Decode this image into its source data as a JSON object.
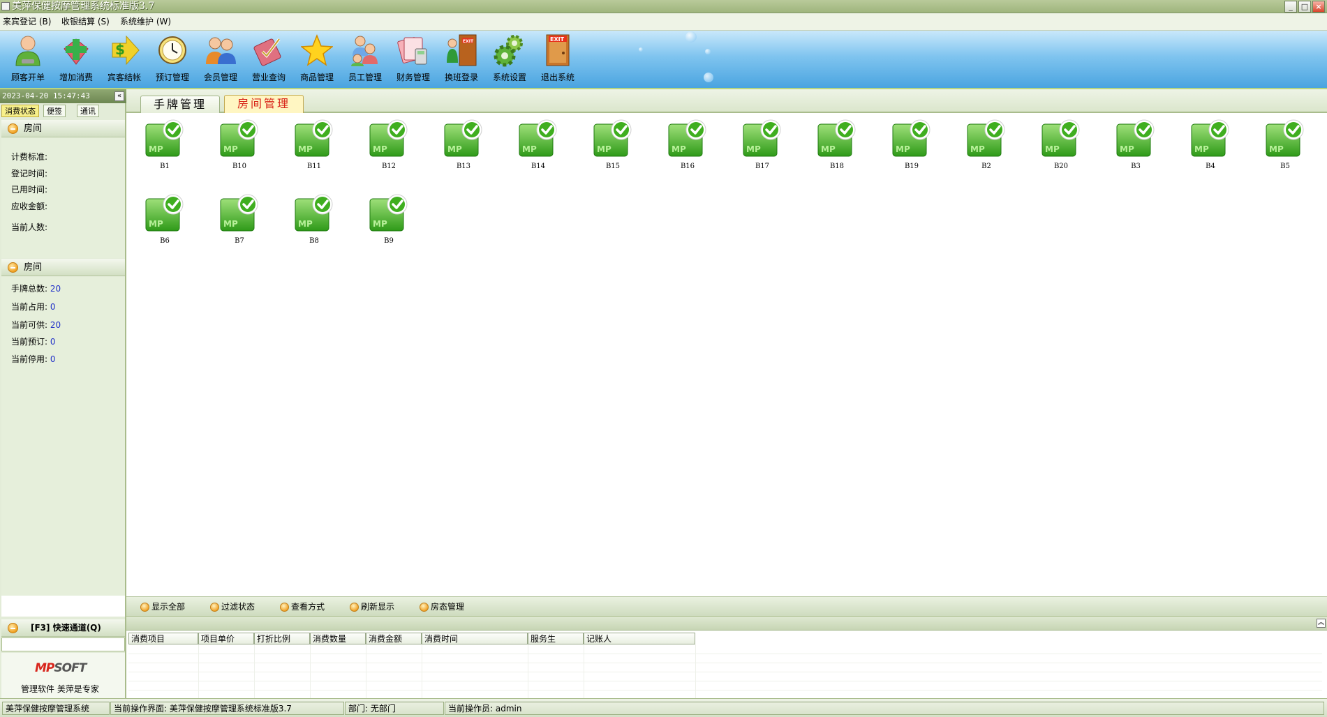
{
  "window": {
    "title": "美萍保健按摩管理系统标准版3.7"
  },
  "menu": [
    "来宾登记 (B)",
    "收银结算 (S)",
    "系统维护 (W)"
  ],
  "toolbar": [
    {
      "label": "顾客开单",
      "icon": "customer-icon"
    },
    {
      "label": "增加消费",
      "icon": "add-consumption-icon"
    },
    {
      "label": "宾客结帐",
      "icon": "checkout-icon"
    },
    {
      "label": "预订管理",
      "icon": "clock-icon"
    },
    {
      "label": "会员管理",
      "icon": "members-icon"
    },
    {
      "label": "营业查询",
      "icon": "query-icon"
    },
    {
      "label": "商品管理",
      "icon": "star-icon"
    },
    {
      "label": "员工管理",
      "icon": "staff-icon"
    },
    {
      "label": "财务管理",
      "icon": "finance-icon"
    },
    {
      "label": "换班登录",
      "icon": "shift-icon"
    },
    {
      "label": "系统设置",
      "icon": "gear-icon"
    },
    {
      "label": "退出系统",
      "icon": "exit-icon"
    }
  ],
  "exit_door_text": "EXIT",
  "left": {
    "datetime": "2023-04-20 15:47:43",
    "tabs": [
      "消费状态",
      "便签",
      "通讯"
    ],
    "section1": {
      "title": "房间",
      "fields": [
        "计费标准:",
        "登记时间:",
        "已用时间:",
        "应收金额:",
        "当前人数:"
      ]
    },
    "section2": {
      "title": "房间",
      "fields": [
        {
          "label": "手牌总数:",
          "value": "20"
        },
        {
          "label": "当前占用:",
          "value": "0"
        },
        {
          "label": "当前可供:",
          "value": "20"
        },
        {
          "label": "当前预订:",
          "value": "0"
        },
        {
          "label": "当前停用:",
          "value": "0"
        }
      ]
    },
    "quick_channel": "[F3] 快速通道(Q)",
    "brand": {
      "logo_mp": "MP",
      "logo_soft": "SOFT",
      "slogan": "管理软件 美萍是专家"
    }
  },
  "main_tabs": [
    "手牌管理",
    "房间管理"
  ],
  "active_main_tab": 1,
  "rooms": [
    "B1",
    "B10",
    "B11",
    "B12",
    "B13",
    "B14",
    "B15",
    "B16",
    "B17",
    "B18",
    "B19",
    "B2",
    "B20",
    "B3",
    "B4",
    "B5",
    "B6",
    "B7",
    "B8",
    "B9"
  ],
  "room_icon_text": "MP",
  "filters": [
    "显示全部",
    "过滤状态",
    "查看方式",
    "刷新显示",
    "房态管理"
  ],
  "table_columns": [
    "消费项目",
    "项目单价",
    "打折比例",
    "消费数量",
    "消费金额",
    "消费时间",
    "服务生",
    "记账人"
  ],
  "status": [
    "美萍保健按摩管理系统",
    "当前操作界面: 美萍保健按摩管理系统标准版3.7",
    "部门: 无部门",
    "当前操作员: admin"
  ],
  "colors": {
    "accent_red": "#d82418",
    "value_blue": "#2030c8",
    "room_green": "#3fae1f"
  }
}
